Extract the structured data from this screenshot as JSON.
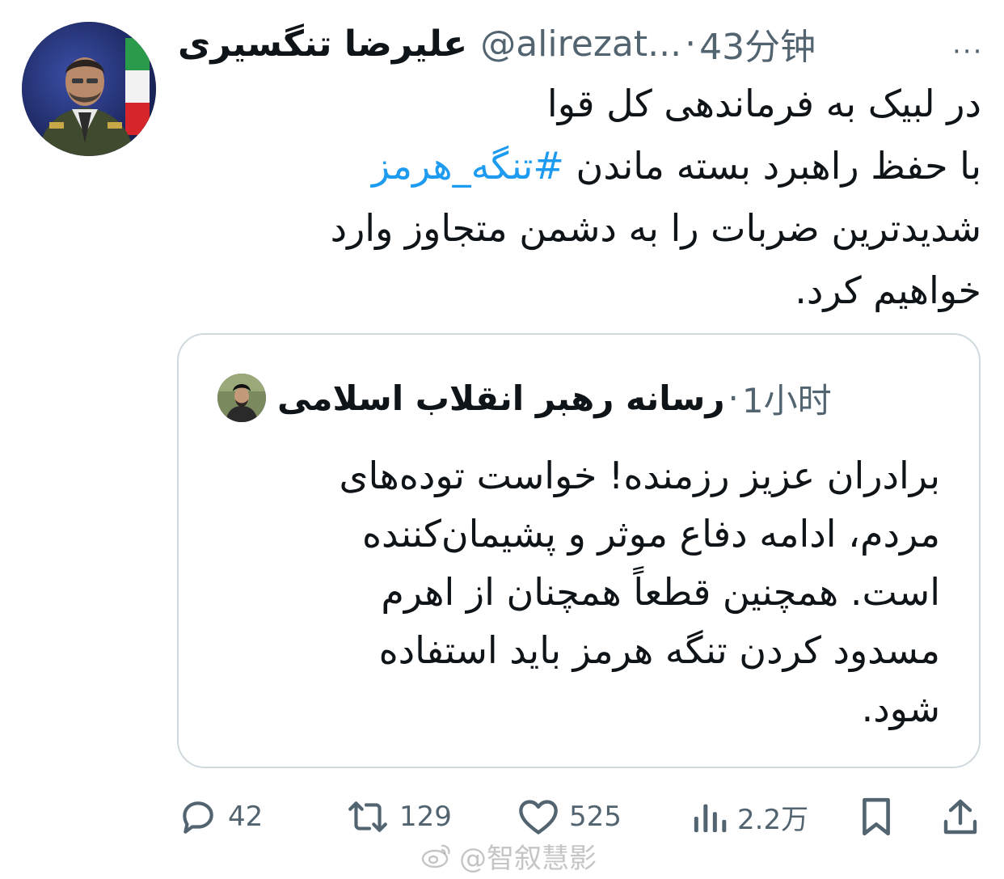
{
  "author": {
    "display_name": "علیرضا تنگسیری",
    "handle": "@alirezat...",
    "separator": "·",
    "time": "43分钟"
  },
  "more_icon_label": "···",
  "tweet": {
    "line1": "در لبیک به فرماندهی کل قوا",
    "line2_pre": "با حفظ راهبرد بسته ماندن ",
    "hashtag": "#تنگه_هرمز",
    "line3": "شدیدترین ضربات را  به دشمن متجاوز وارد",
    "line4": "خواهیم کرد."
  },
  "quote": {
    "display_name": "رسانه رهبر انقلاب اسلامی",
    "separator": "·",
    "time": "1小时",
    "lines": [
      "برادران عزیز رزمنده! خواست توده‌های",
      "مردم، ادامه دفاع موثر و پشیمان‌کننده",
      "است. همچنین قطعاً همچنان از اهرم",
      "مسدود کردن تنگه هرمز باید استفاده",
      "شود."
    ]
  },
  "actions": {
    "reply_count": "42",
    "retweet_count": "129",
    "like_count": "525",
    "views_count": "2.2万"
  },
  "icons": {
    "reply": "reply-icon",
    "retweet": "retweet-icon",
    "like": "heart-icon",
    "views": "views-icon",
    "bookmark": "bookmark-icon",
    "share": "share-icon"
  },
  "colors": {
    "hashtag": "#1d9bf0",
    "secondary_text": "#536471",
    "border": "#cfd9de"
  },
  "watermark": "@智叙慧影"
}
